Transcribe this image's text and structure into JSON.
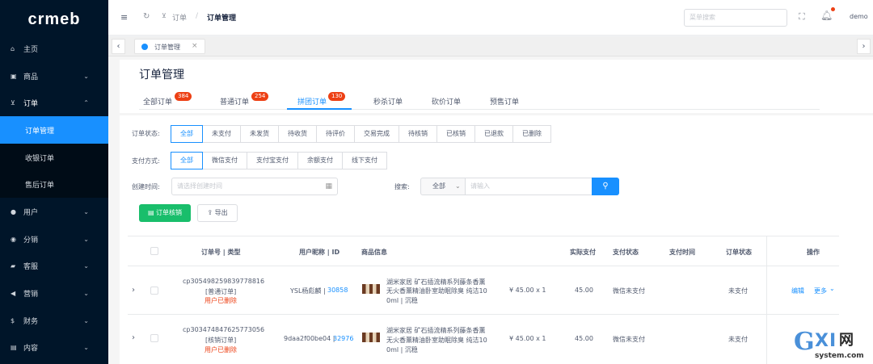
{
  "sidebar": {
    "logo": "crmeb",
    "items": [
      {
        "label": "主页",
        "icon": "home-icon",
        "glyph": "⌂"
      },
      {
        "label": "商品",
        "icon": "goods-icon",
        "glyph": "▣"
      },
      {
        "label": "订单",
        "icon": "cart-icon",
        "glyph": "⊻"
      },
      {
        "label": "用户",
        "icon": "user-icon",
        "glyph": "●"
      },
      {
        "label": "分销",
        "icon": "distribution-icon",
        "glyph": "◉"
      },
      {
        "label": "客服",
        "icon": "service-icon",
        "glyph": "▰"
      },
      {
        "label": "营销",
        "icon": "marketing-icon",
        "glyph": "◀"
      },
      {
        "label": "财务",
        "icon": "finance-icon",
        "glyph": "$"
      },
      {
        "label": "内容",
        "icon": "content-icon",
        "glyph": "▤"
      }
    ],
    "sub_items": [
      {
        "label": "订单管理"
      },
      {
        "label": "收银订单"
      },
      {
        "label": "售后订单"
      }
    ]
  },
  "header": {
    "breadcrumb_parent": "订单",
    "breadcrumb_sep": "/",
    "breadcrumb_current": "订单管理",
    "search_placeholder": "菜单搜索",
    "username": "demo"
  },
  "tagsbar": {
    "tag_label": "订单管理",
    "close": "×"
  },
  "page": {
    "title": "订单管理",
    "tabs": [
      {
        "label": "全部订单",
        "badge": "384"
      },
      {
        "label": "普通订单",
        "badge": "254"
      },
      {
        "label": "拼团订单",
        "badge": "130"
      },
      {
        "label": "秒杀订单",
        "badge": ""
      },
      {
        "label": "砍价订单",
        "badge": ""
      },
      {
        "label": "预售订单",
        "badge": ""
      }
    ]
  },
  "filters": {
    "status_label": "订单状态:",
    "status_options": [
      "全部",
      "未支付",
      "未发货",
      "待收货",
      "待评价",
      "交易完成",
      "待核销",
      "已核销",
      "已退款",
      "已删除"
    ],
    "pay_label": "支付方式:",
    "pay_options": [
      "全部",
      "微信支付",
      "支付宝支付",
      "余额支付",
      "线下支付"
    ],
    "time_label": "创建时间:",
    "time_placeholder": "请选择创建时间",
    "search_label": "搜索:",
    "search_scope": "全部",
    "search_placeholder": "请输入"
  },
  "actions": {
    "verify_button": "订单核销",
    "export_button": "导出"
  },
  "table": {
    "headers": [
      "订单号 | 类型",
      "用户昵称 | ID",
      "商品信息",
      "实际支付",
      "支付状态",
      "支付时间",
      "订单状态",
      "操作"
    ],
    "rows": [
      {
        "order_no": "cp305498259839778816",
        "type": "[普通订单]",
        "deleted": "用户已删除",
        "nickname": "YSL杨彪麟 | ",
        "uid": "30858",
        "goods_line1": "湖米家居 矿石插流精系列藤条香薰",
        "goods_line2": "无火香薰精油卧室助眠除臭 纯洁10",
        "goods_line3": "0ml | 沉稳",
        "price_qty": "¥ 45.00 x 1",
        "paid": "45.00",
        "pay_status": "微信未支付",
        "pay_time": "",
        "order_status": "未支付",
        "edit": "编辑",
        "more": "更多"
      },
      {
        "order_no": "cp303474847625773056",
        "type": "[核销订单]",
        "deleted": "用户已删除",
        "nickname": "9daa2f00be04 | ",
        "uid": "32976",
        "goods_line1": "湖米家居 矿石插流精系列藤条香薰",
        "goods_line2": "无火香薰精油卧室助眠除臭 纯洁10",
        "goods_line3": "0ml | 沉稳",
        "price_qty": "¥ 45.00 x 1",
        "paid": "45.00",
        "pay_status": "微信未支付",
        "pay_time": "",
        "order_status": "未支付",
        "edit": "编辑",
        "more": "更多"
      }
    ]
  },
  "watermark": "GXI网 system.com",
  "colors": {
    "primary": "#1890ff",
    "sidebar": "#001529",
    "green": "#19be6b",
    "red": "#ed4014"
  }
}
